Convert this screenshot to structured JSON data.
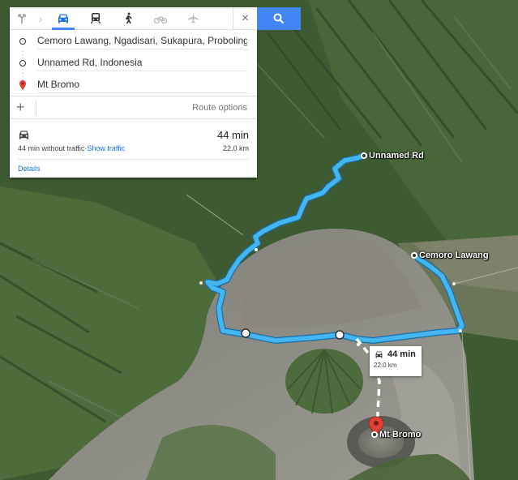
{
  "travel_modes": [
    {
      "name": "best-mode",
      "icon": "route-arrow-icon"
    },
    {
      "name": "driving",
      "icon": "car-icon",
      "active": true
    },
    {
      "name": "transit",
      "icon": "train-icon"
    },
    {
      "name": "walking",
      "icon": "walking-icon"
    },
    {
      "name": "cycling",
      "icon": "bicycle-icon"
    },
    {
      "name": "flights",
      "icon": "airplane-icon"
    }
  ],
  "close_icon": "×",
  "search_icon": "search-icon",
  "stops": [
    {
      "text": "Cemoro Lawang, Ngadisari, Sukapura, Probolingg"
    },
    {
      "text": "Unnamed Rd, Indonesia"
    },
    {
      "text": "Mt Bromo"
    }
  ],
  "add_destination": "+",
  "route_options": "Route options",
  "summary": {
    "time": "44 min",
    "without_traffic": "44 min without traffic",
    "separator": " · ",
    "show_traffic": "Show traffic",
    "distance": "22.0 km",
    "details": "Details"
  },
  "map_labels": {
    "unnamed_rd": "Unnamed Rd",
    "cemoro_lawang": "Cemoro Lawang",
    "mt_bromo": "Mt Bromo"
  },
  "route_callout": {
    "time": "44 min",
    "distance": "22.0 km"
  },
  "colors": {
    "route": "#45b5f0",
    "accent": "#4285f4",
    "pin": "#db4437"
  }
}
